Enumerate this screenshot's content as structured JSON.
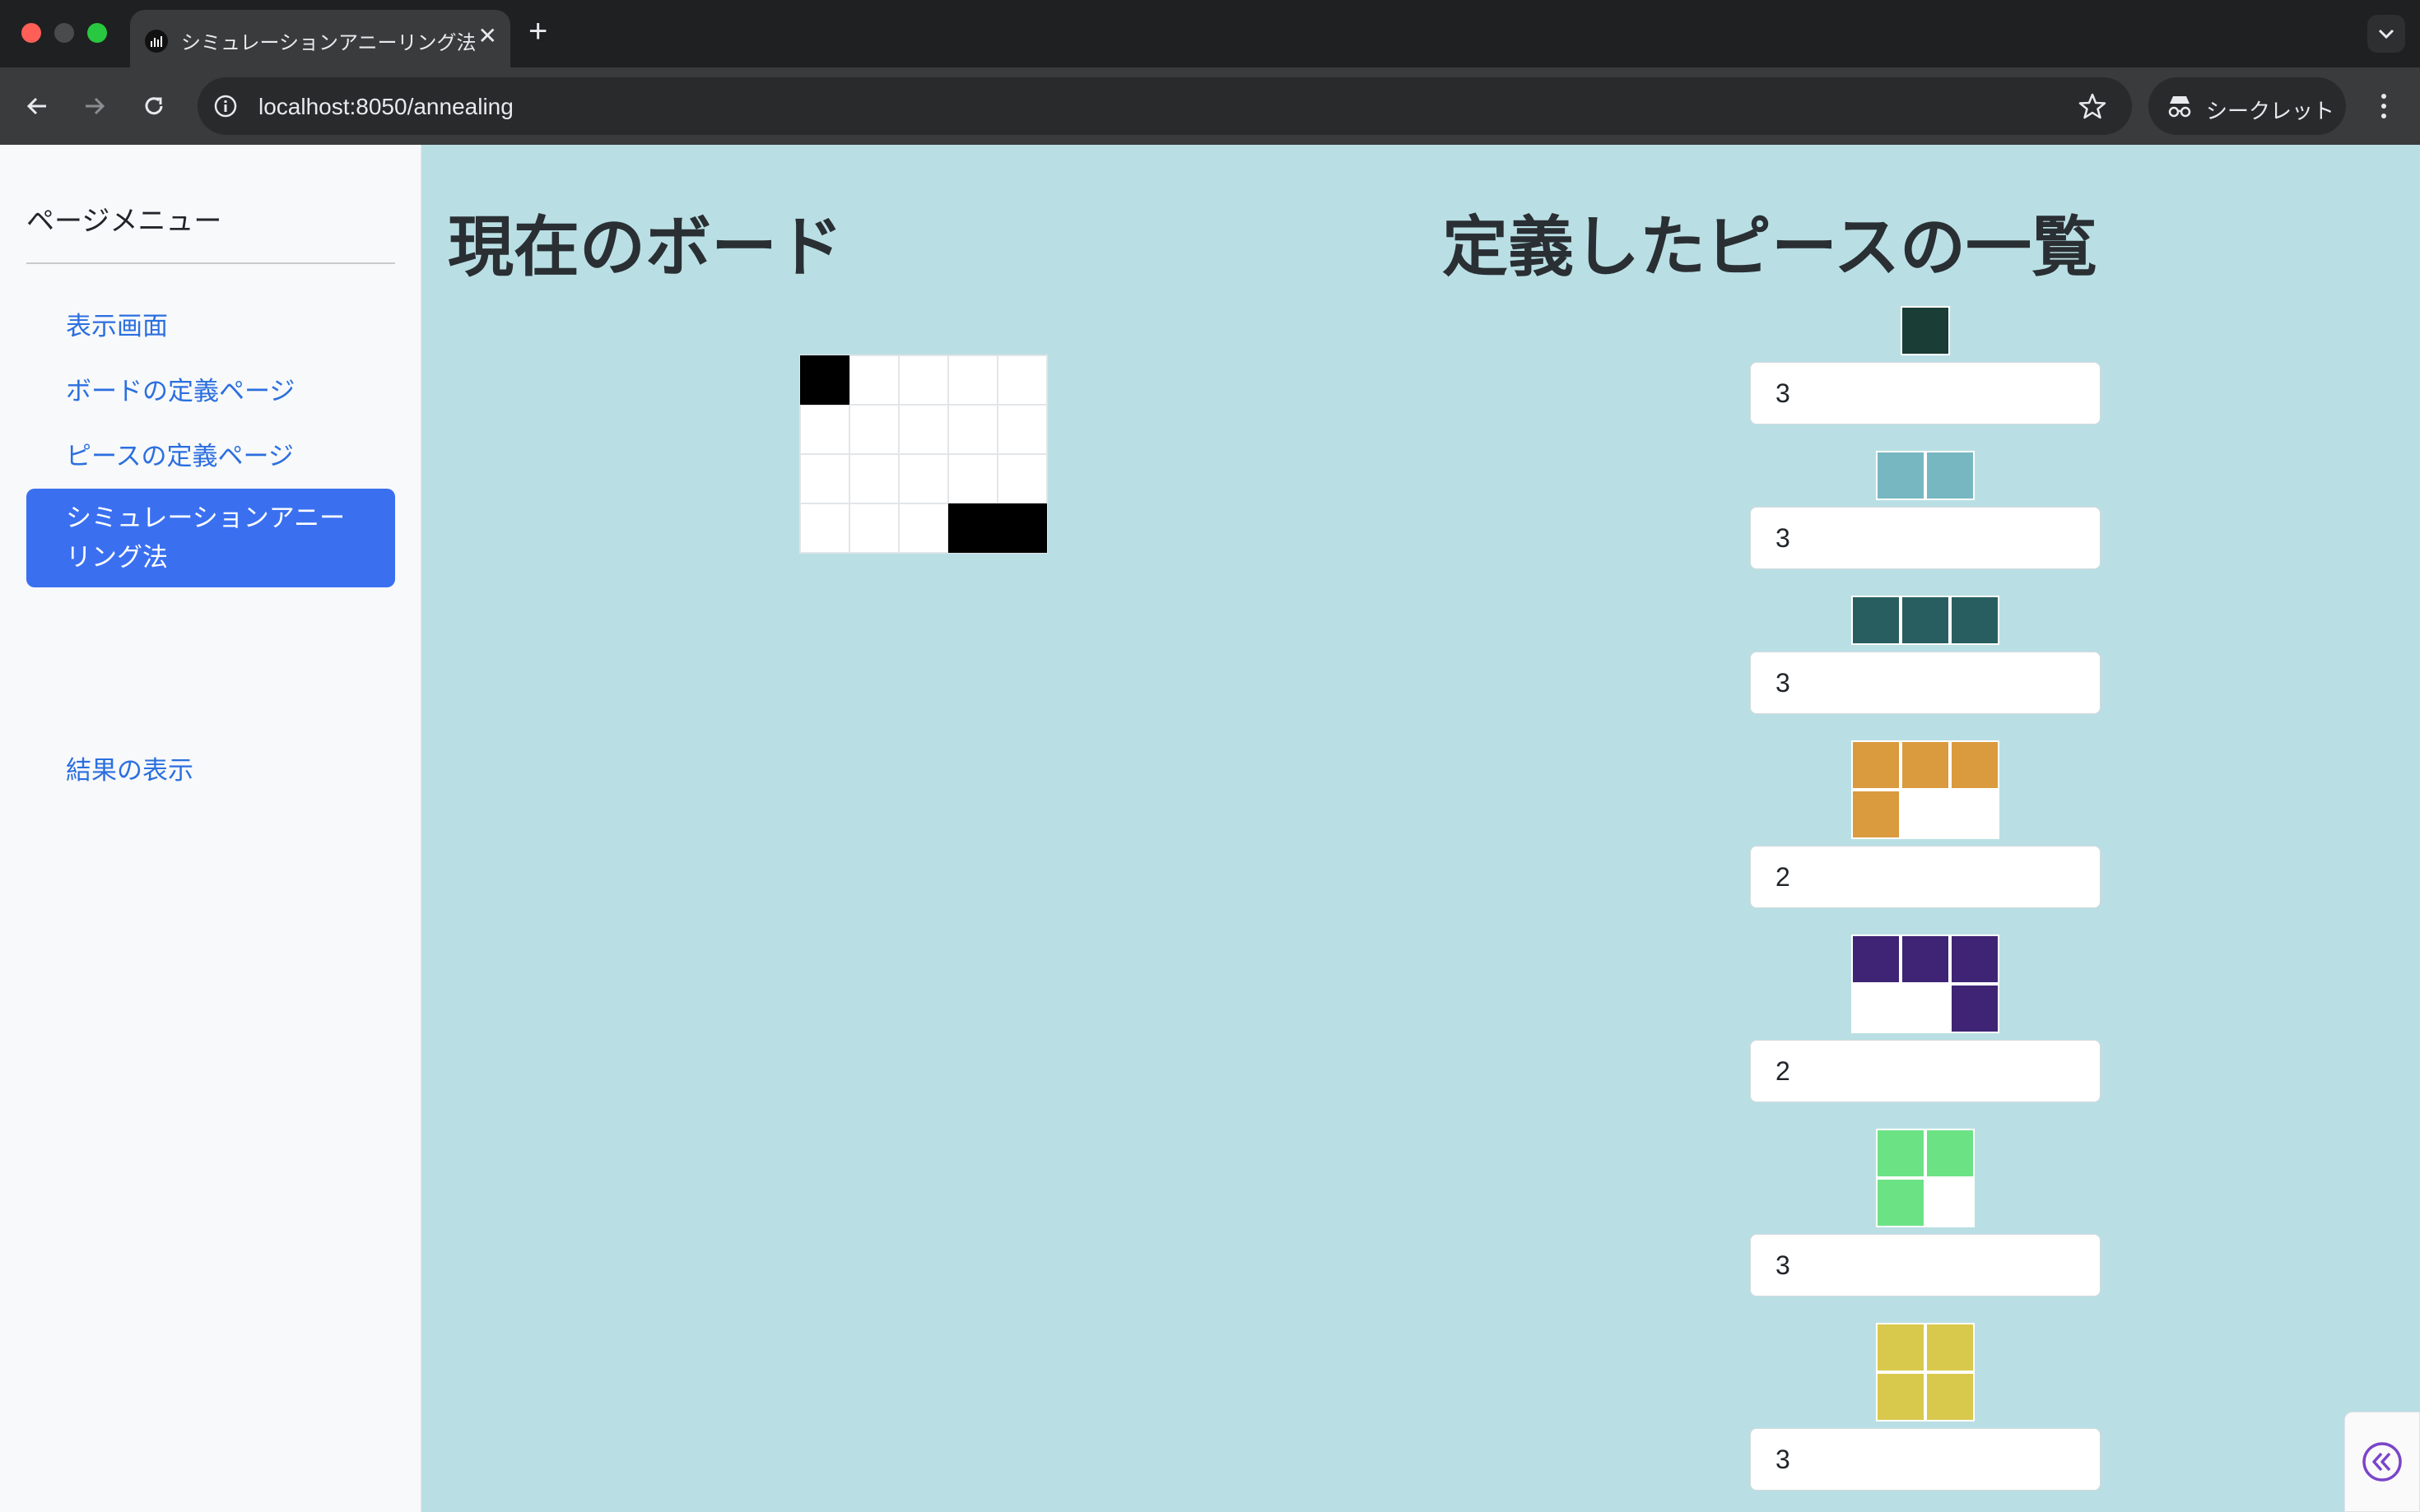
{
  "browser": {
    "tab_title": "シミュレーションアニーリング法",
    "tab_close": "✕",
    "new_tab": "+",
    "url": "localhost:8050/annealing",
    "incognito_label": "シークレット"
  },
  "sidebar": {
    "title": "ページメニュー",
    "items": [
      {
        "label": "表示画面",
        "active": false
      },
      {
        "label": "ボードの定義ページ",
        "active": false
      },
      {
        "label": "ピースの定義ページ",
        "active": false
      },
      {
        "label": "シミュレーションアニーリング法",
        "active": true
      },
      {
        "label": "結果の表示",
        "active": false
      }
    ]
  },
  "main": {
    "board_heading": "現在のボード",
    "pieces_heading": "定義したピースの一覧",
    "board": [
      [
        1,
        0,
        0,
        0,
        0
      ],
      [
        0,
        0,
        0,
        0,
        0
      ],
      [
        0,
        0,
        0,
        0,
        0
      ],
      [
        0,
        0,
        0,
        1,
        1
      ]
    ],
    "pieces": [
      {
        "color": "#1a3d35",
        "shape": [
          [
            1
          ]
        ],
        "quantity": "3"
      },
      {
        "color": "#77b7c2",
        "shape": [
          [
            1,
            1
          ]
        ],
        "quantity": "3"
      },
      {
        "color": "#285e5f",
        "shape": [
          [
            1,
            1,
            1
          ]
        ],
        "quantity": "3"
      },
      {
        "color": "#da9a3e",
        "shape": [
          [
            1,
            1,
            1
          ],
          [
            1,
            0,
            0
          ]
        ],
        "quantity": "2"
      },
      {
        "color": "#3f2475",
        "shape": [
          [
            1,
            1,
            1
          ],
          [
            0,
            0,
            1
          ]
        ],
        "quantity": "2"
      },
      {
        "color": "#6be384",
        "shape": [
          [
            1,
            1
          ],
          [
            1,
            0
          ]
        ],
        "quantity": "3"
      },
      {
        "color": "#d8c94c",
        "shape": [
          [
            1,
            1
          ],
          [
            1,
            1
          ]
        ],
        "quantity": "3"
      }
    ]
  },
  "colors": {
    "page_background": "#b9dfe4",
    "active_nav": "#3a70f0",
    "link": "#2b6fe0"
  },
  "icons": [
    "chart-favicon-icon",
    "close-icon",
    "plus-icon",
    "chevron-down-icon",
    "back-arrow-icon",
    "forward-arrow-icon",
    "reload-icon",
    "site-info-icon",
    "star-icon",
    "incognito-icon",
    "more-vert-icon",
    "collapse-double-chevron-icon"
  ]
}
